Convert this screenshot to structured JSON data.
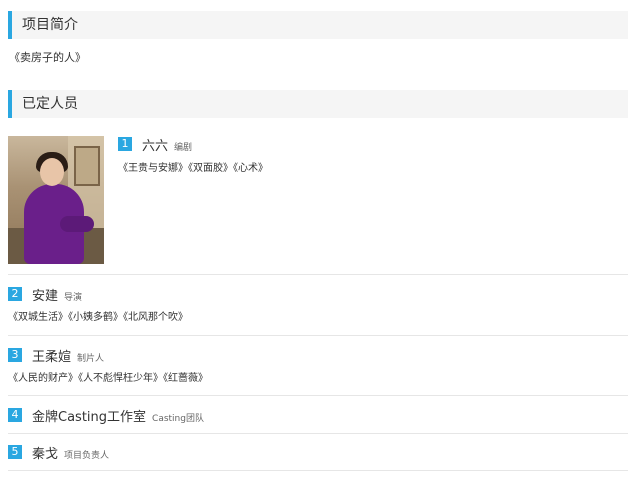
{
  "sections": {
    "summary_title": "项目简介",
    "summary_text": "《卖房子的人》",
    "crew_title": "已定人员"
  },
  "crew": [
    {
      "num": "1",
      "name": "六六",
      "role": "编剧",
      "works": "《王贵与安娜》《双面胶》《心术》"
    },
    {
      "num": "2",
      "name": "安建",
      "role": "导演",
      "works": "《双城生活》《小姨多鹤》《北风那个吹》"
    },
    {
      "num": "3",
      "name": "王柔媗",
      "role": "制片人",
      "works": "《人民的财产》《人不彪悍枉少年》《红蔷薇》"
    },
    {
      "num": "4",
      "name": "金牌Casting工作室",
      "role": "Casting团队",
      "works": ""
    },
    {
      "num": "5",
      "name": "秦戈",
      "role": "项目负责人",
      "works": ""
    }
  ],
  "colors": {
    "accent": "#2aa7e1"
  }
}
